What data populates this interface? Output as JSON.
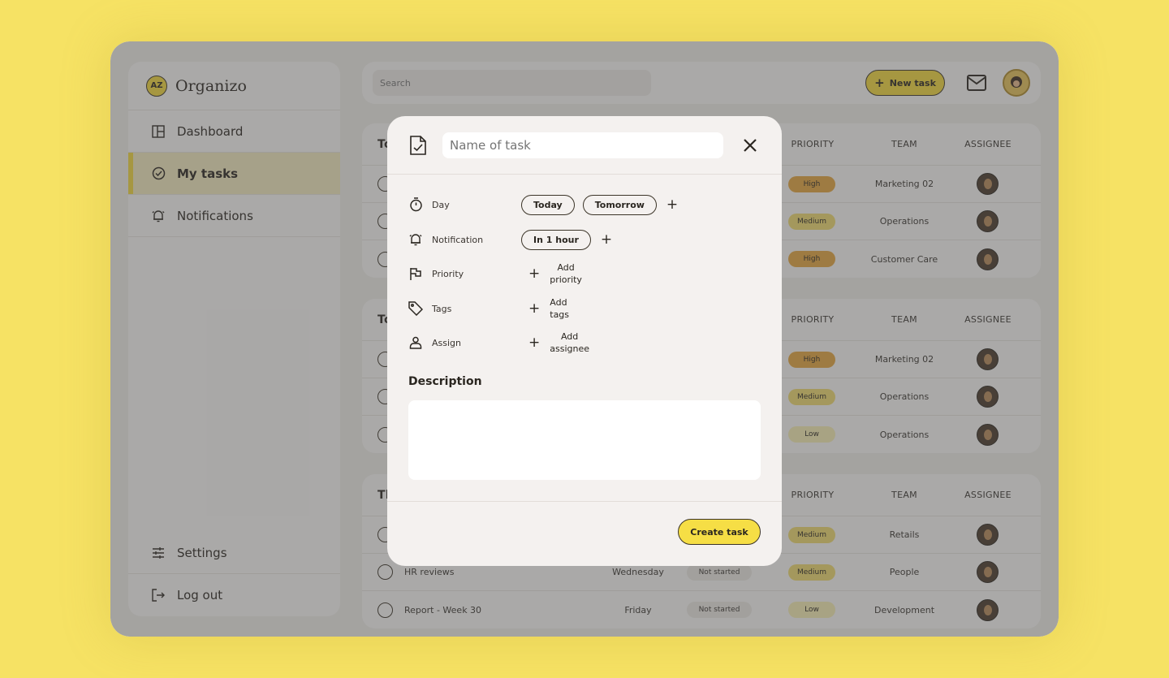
{
  "app": {
    "name": "Organizo",
    "logo_text": "AZ"
  },
  "sidebar": {
    "items": [
      {
        "label": "Dashboard",
        "icon": "dashboard-icon",
        "active": false
      },
      {
        "label": "My tasks",
        "icon": "check-circle-icon",
        "active": true
      },
      {
        "label": "Notifications",
        "icon": "bell-icon",
        "active": false
      }
    ],
    "bottom_items": [
      {
        "label": "Settings",
        "icon": "sliders-icon"
      },
      {
        "label": "Log out",
        "icon": "logout-icon"
      }
    ]
  },
  "topbar": {
    "search_placeholder": "Search",
    "new_task_label": "New task"
  },
  "table": {
    "headers": {
      "priority": "PRIORITY",
      "team": "TEAM",
      "assignee": "ASSIGNEE"
    },
    "groups": [
      {
        "title": "To",
        "rows": [
          {
            "name": "",
            "day": "",
            "status": "",
            "priority": "High",
            "team": "Marketing 02"
          },
          {
            "name": "",
            "day": "",
            "status": "",
            "priority": "Medium",
            "team": "Operations"
          },
          {
            "name": "",
            "day": "",
            "status": "",
            "priority": "High",
            "team": "Customer Care"
          }
        ]
      },
      {
        "title": "To",
        "rows": [
          {
            "name": "",
            "day": "",
            "status": "",
            "priority": "High",
            "team": "Marketing 02"
          },
          {
            "name": "",
            "day": "",
            "status": "",
            "priority": "Medium",
            "team": "Operations"
          },
          {
            "name": "",
            "day": "",
            "status": "",
            "priority": "Low",
            "team": "Operations"
          }
        ]
      },
      {
        "title": "Th",
        "rows": [
          {
            "name": "",
            "day": "",
            "status": "",
            "priority": "Medium",
            "team": "Retails"
          },
          {
            "name": "HR reviews",
            "day": "Wednesday",
            "status": "Not started",
            "priority": "Medium",
            "team": "People"
          },
          {
            "name": "Report - Week 30",
            "day": "Friday",
            "status": "Not started",
            "priority": "Low",
            "team": "Development"
          }
        ]
      }
    ]
  },
  "modal": {
    "name_placeholder": "Name of task",
    "fields": {
      "day": {
        "label": "Day",
        "chips": [
          "Today",
          "Tomorrow"
        ]
      },
      "notification": {
        "label": "Notification",
        "chips": [
          "In 1 hour"
        ]
      },
      "priority": {
        "label": "Priority",
        "add_line1": "Add",
        "add_line2": "priority"
      },
      "tags": {
        "label": "Tags",
        "add_line1": "Add",
        "add_line2": "tags"
      },
      "assign": {
        "label": "Assign",
        "add_line1": "Add",
        "add_line2": "assignee"
      }
    },
    "description_label": "Description",
    "description_value": "",
    "create_label": "Create task"
  },
  "colors": {
    "background": "#f6e264",
    "accent": "#f4d93c",
    "priority_high": "#e6a73e",
    "priority_medium": "#f1db70",
    "priority_low": "#f7eeb4"
  }
}
